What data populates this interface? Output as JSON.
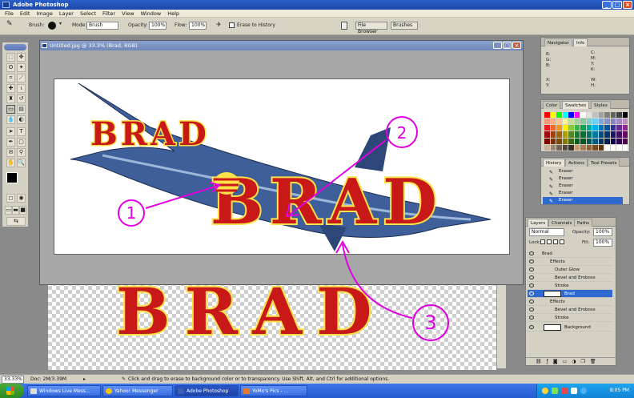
{
  "app": {
    "title": "Adobe Photoshop"
  },
  "menu": [
    "File",
    "Edit",
    "Image",
    "Layer",
    "Select",
    "Filter",
    "View",
    "Window",
    "Help"
  ],
  "options": {
    "brush_label": "Brush:",
    "mode_label": "Mode:",
    "mode_value": "Brush",
    "opacity_label": "Opacity:",
    "opacity_value": "100%",
    "flow_label": "Flow:",
    "flow_value": "100%",
    "erase_history_label": "Erase to History",
    "file_browser_label": "File Browser",
    "brushes_label": "Brushes"
  },
  "document": {
    "title": "Untitled.jpg @ 33.3% (Brad, RGB)",
    "artwork_text": "BRAD",
    "annotations": [
      "1",
      "2",
      "3"
    ]
  },
  "navigator": {
    "tabs": [
      "Navigator",
      "Info"
    ],
    "labels": [
      "R:",
      "G:",
      "B:",
      "C:",
      "M:",
      "Y:",
      "K:",
      "X:",
      "Y:",
      "W:",
      "H:"
    ]
  },
  "swatches": {
    "tabs": [
      "Color",
      "Swatches",
      "Styles"
    ]
  },
  "history": {
    "tabs": [
      "History",
      "Actions",
      "Tool Presets"
    ],
    "items": [
      "Eraser",
      "Eraser",
      "Eraser",
      "Eraser",
      "Eraser"
    ]
  },
  "layers": {
    "tabs": [
      "Layers",
      "Channels",
      "Paths"
    ],
    "blend_mode": "Normal",
    "opacity_label": "Opacity:",
    "opacity_value": "100%",
    "lock_label": "Lock:",
    "fill_label": "Fill:",
    "fill_value": "100%",
    "rows": [
      "Brad",
      "Effects",
      "Outer Glow",
      "Bevel and Emboss",
      "Stroke",
      "Brad",
      "Effects",
      "Bevel and Emboss",
      "Stroke",
      "Background"
    ]
  },
  "status": {
    "zoom": "33.33%",
    "doc_size": "Doc: 2M/3.39M",
    "hint": "Click and drag to erase to background color or to transparency. Use Shift, Alt, and Ctrl for additional options."
  },
  "taskbar": {
    "items": [
      "Windows Live Mess...",
      "Yahoo! Messenger",
      "Adobe Photoshop",
      "YoMo's Pics - ..."
    ],
    "time": "8:05 PM"
  },
  "colors": {
    "titlebar": "#1b46a8",
    "annotation": "#e000e0",
    "brad_red": "#c81818",
    "brad_yellow": "#ffe14a"
  }
}
